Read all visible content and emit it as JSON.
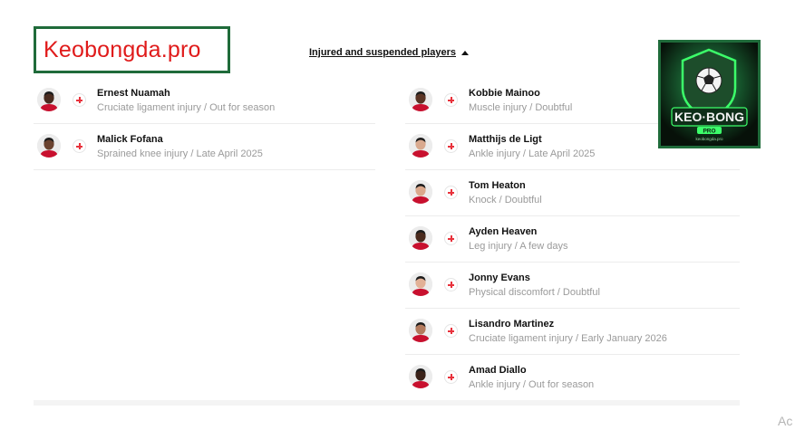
{
  "watermark": {
    "text": "Keobongda.pro"
  },
  "section": {
    "title": "Injured and suspended players",
    "toggle_icon": "caret-up-icon"
  },
  "logo": {
    "text": "KEO·BONG",
    "subtext": "PRO",
    "url_text": "keobongda.pro",
    "colors": {
      "glow": "#3cff6a",
      "shield": "#1d4d2b"
    }
  },
  "icons": {
    "badge": "red-cross-icon",
    "avatar": "player-photo"
  },
  "colors": {
    "accent_red": "#e8323c",
    "watermark_red": "#e01b1b",
    "frame_green": "#1f6b3a"
  },
  "players_left": [
    {
      "name": "Ernest Nuamah",
      "status": "Cruciate ligament injury / Out for season",
      "skin": "#4a2c20"
    },
    {
      "name": "Malick Fofana",
      "status": "Sprained knee injury / Late April 2025",
      "skin": "#6b4330"
    }
  ],
  "players_right": [
    {
      "name": "Kobbie Mainoo",
      "status": "Muscle injury / Doubtful",
      "skin": "#5a3424"
    },
    {
      "name": "Matthijs de Ligt",
      "status": "Ankle injury / Late April 2025",
      "skin": "#d9a98e"
    },
    {
      "name": "Tom Heaton",
      "status": "Knock / Doubtful",
      "skin": "#dba88c"
    },
    {
      "name": "Ayden Heaven",
      "status": "Leg injury / A few days",
      "skin": "#4a2a1d"
    },
    {
      "name": "Jonny Evans",
      "status": "Physical discomfort / Doubtful",
      "skin": "#e2b197"
    },
    {
      "name": "Lisandro Martinez",
      "status": "Cruciate ligament injury / Early January 2026",
      "skin": "#b37a5d"
    },
    {
      "name": "Amad Diallo",
      "status": "Ankle injury / Out for season",
      "skin": "#3b2219"
    }
  ],
  "corner": {
    "text": "Ac"
  }
}
